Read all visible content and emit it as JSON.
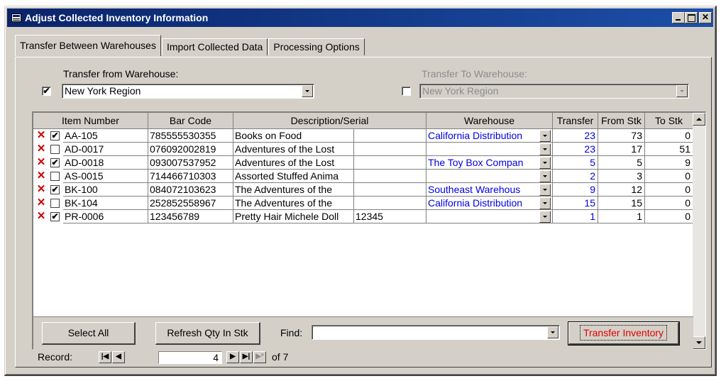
{
  "window": {
    "title": "Adjust Collected Inventory Information"
  },
  "tabs": [
    {
      "label": "Transfer Between Warehouses",
      "active": true
    },
    {
      "label": "Import Collected Data",
      "active": false
    },
    {
      "label": "Processing Options",
      "active": false
    }
  ],
  "transfer_from": {
    "label": "Transfer from Warehouse:",
    "checked": true,
    "value": "New York Region"
  },
  "transfer_to": {
    "label": "Transfer To Warehouse:",
    "checked": false,
    "value": "New York Region",
    "disabled": true
  },
  "grid": {
    "columns": [
      "Item Number",
      "Bar Code",
      "Description/Serial",
      "Warehouse",
      "Transfer",
      "From Stk",
      "To Stk"
    ],
    "rows": [
      {
        "checked": true,
        "item": "AA-105",
        "barcode": "785555530355",
        "description": "Books on Food",
        "serial": "",
        "warehouse": "California Distribution",
        "transfer": "23",
        "from_stk": "73",
        "to_stk": "0"
      },
      {
        "checked": false,
        "item": "AD-0017",
        "barcode": "076092002819",
        "description": "Adventures of the Lost",
        "serial": "",
        "warehouse": "",
        "transfer": "23",
        "from_stk": "17",
        "to_stk": "51"
      },
      {
        "checked": true,
        "item": "AD-0018",
        "barcode": "093007537952",
        "description": "Adventures of the Lost",
        "serial": "",
        "warehouse": "The Toy Box Compan",
        "transfer": "5",
        "from_stk": "5",
        "to_stk": "9"
      },
      {
        "checked": false,
        "item": "AS-0015",
        "barcode": "714466710303",
        "description": "Assorted Stuffed Anima",
        "serial": "",
        "warehouse": "",
        "transfer": "2",
        "from_stk": "3",
        "to_stk": "0"
      },
      {
        "checked": true,
        "item": "BK-100",
        "barcode": "084072103623",
        "description": "The Adventures of the",
        "serial": "",
        "warehouse": "Southeast Warehous",
        "transfer": "9",
        "from_stk": "12",
        "to_stk": "0"
      },
      {
        "checked": false,
        "item": "BK-104",
        "barcode": "252852558967",
        "description": "The Adventures of the",
        "serial": "",
        "warehouse": "California Distribution",
        "transfer": "15",
        "from_stk": "15",
        "to_stk": "0"
      },
      {
        "checked": true,
        "item": "PR-0006",
        "barcode": "123456789",
        "description": "Pretty Hair Michele Doll",
        "serial": "12345",
        "warehouse": "",
        "transfer": "1",
        "from_stk": "1",
        "to_stk": "0"
      }
    ]
  },
  "footer": {
    "select_all": "Select All",
    "refresh": "Refresh Qty In Stk",
    "find_label": "Find:",
    "find_value": "",
    "transfer": "Transfer Inventory"
  },
  "nav": {
    "label": "Record:",
    "current": "4",
    "of_text": "of 7"
  },
  "colors": {
    "title_bar": "#0a246a",
    "link_blue": "#0000e0",
    "delete_red": "#cc0000",
    "transfer_text": "#e00000"
  },
  "icons": [
    "form-icon",
    "minimize-icon",
    "maximize-icon",
    "close-icon",
    "delete-x-icon",
    "dropdown-arrow-icon",
    "first-record-icon",
    "prev-record-icon",
    "next-record-icon",
    "last-record-icon",
    "new-record-icon"
  ]
}
